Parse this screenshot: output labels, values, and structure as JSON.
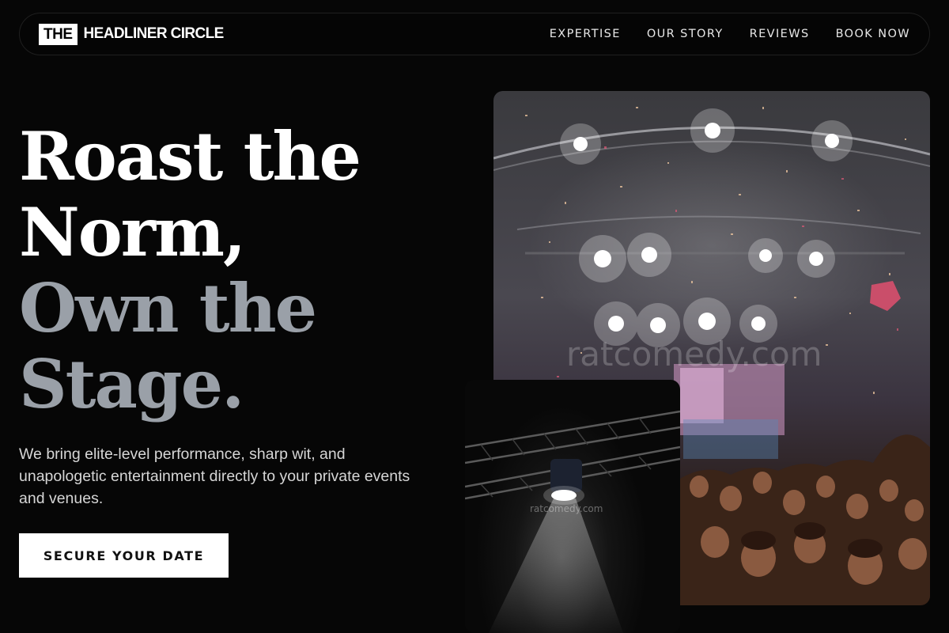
{
  "nav": {
    "logo_box": "THE",
    "logo_text": "HEADLINER CIRCLE",
    "links": [
      "EXPERTISE",
      "OUR STORY",
      "REVIEWS",
      "BOOK NOW"
    ]
  },
  "hero": {
    "headline": [
      "Roast the",
      "Norm,",
      "Own the",
      "Stage."
    ],
    "subtitle": "We bring elite-level performance, sharp wit, and unapologetic entertainment directly to your private events and venues.",
    "cta": "SECURE YOUR DATE"
  },
  "images": {
    "main_watermark": "ratcomedy.com",
    "inset_watermark": "ratcomedy.com"
  },
  "colors": {
    "background": "#060606",
    "headline_dim": "#9aa0a8",
    "cta_bg": "#ffffff"
  }
}
